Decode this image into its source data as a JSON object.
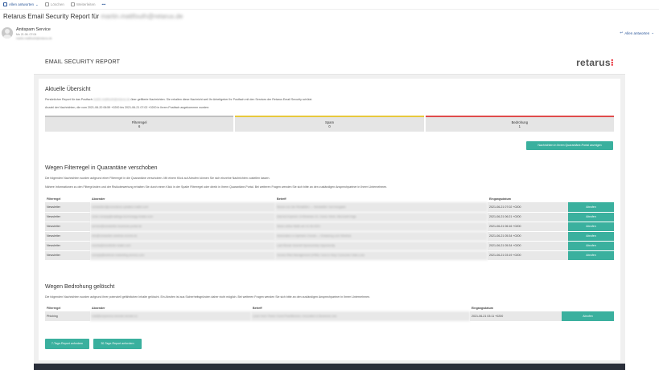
{
  "toolbar": {
    "reply_all": "Allen antworten",
    "delete": "Löschen",
    "forward": "Weiterleiten",
    "more": "•••"
  },
  "mail": {
    "subject": "Retarus Email Security Report für",
    "subject_address": "martin.mattfouth@retarus.de",
    "sender_name": "Antispam Service",
    "sender_date": "Mo 21.06. 07:04",
    "sender_to": "martin.mattfouth@retarus.de",
    "reply_all_label": "Allen antworten"
  },
  "report": {
    "title": "EMAIL SECURITY REPORT",
    "logo_text": "retarus",
    "logo_mark": "⁝",
    "overview": {
      "heading": "Aktuelle Übersicht",
      "line1_a": "Persönlicher Report für das Postfach",
      "line1_address": "martin.mattfouth@retarus.de",
      "line1_b": "über gefilterte Nachrichten. Sie erhalten diese Nachricht weil Ihr Arbeitgeber Ihr Postfach mit den Services der Retarus Email Security schützt.",
      "line2": "Anzahl der Nachrichten, die vom 2021-06-20 06:59 +0200 bis 2021-06-21 07:02 +0200 in Ihrem Postfach angekommen wurden:"
    },
    "stats": [
      {
        "label": "Filterregel",
        "value": "6",
        "color": "#c0c0c0"
      },
      {
        "label": "Spam",
        "value": "0",
        "color": "#e8c83c"
      },
      {
        "label": "Bedrohung",
        "value": "1",
        "color": "#e04b4b"
      }
    ],
    "release_all_button": "Nachrichten in Ihrem Quarantäne-Portal anzeigen",
    "quarantine": {
      "heading": "Wegen Filterregel in Quarantäne verschoben",
      "line1": "Die folgenden Nachrichten wurden aufgrund einer Filterregel in die Quarantäne verschoben. Mit einem Klick auf Abrufen können Sie sich einzelne Nachrichten zustellen lassen.",
      "line2": "Nähere Informationen zu den Filtergründen und der Risikobewertung erhalten Sie durch einen Klick in der Spalte Filterregel oder direkt in Ihrem Quarantäne-Portal. Bei weiteren Fragen wenden Sie sich bitte an den zuständigen Ansprechpartner in Ihrem Unternehmen.",
      "columns": [
        "Filterregel",
        "Absender",
        "Betreff",
        "Eingangsdatum",
        ""
      ],
      "rows": [
        {
          "rule": "Newsletter",
          "sender": "newsletter@promotions-updates-mailer.com",
          "subject": "Neues von der Redaktion — Newsletter Juni Ausgabe",
          "date": "2021-06-21 07:02 +0200",
          "action": "Abrufen"
        },
        {
          "rule": "Newsletter",
          "sender": "news-noreply@mailings-technology-insider.com",
          "subject": "Internet Explorer of Windows 10, Cloud, Work: Microsoft Edge",
          "date": "2021-06-21 06:21 +0200",
          "action": "Abrufen"
        },
        {
          "rule": "Newsletter",
          "sender": "service@newsletter-business-portal.de",
          "subject": "News online Nette am 21.06.2021",
          "date": "2021-06-21 06:16 +0200",
          "action": "Abrufen"
        },
        {
          "rule": "Newsletter",
          "sender": "info@newsletter-webinar-events.de",
          "subject": "Automation in hybriden Clouds — Einladung zum Webinar",
          "date": "2021-06-21 05:34 +0200",
          "action": "Abrufen"
        },
        {
          "rule": "Newsletter",
          "sender": "events@eventbrite-mailer.com",
          "subject": "Last Minute Summit Sponsorship Opportunity",
          "date": "2021-06-21 05:34 +0200",
          "action": "Abrufen"
        },
        {
          "rule": "Newsletter",
          "sender": "noreply@webinar-marketing-service.com",
          "subject": "Vendor Risk Management (VRM): How to Stop Consumer Data Loss",
          "date": "2021-06-21 03:19 +0200",
          "action": "Abrufen"
        }
      ]
    },
    "threat": {
      "heading": "Wegen Bedrohung gelöscht",
      "line1": "Die folgenden Nachrichten wurden aufgrund ihrer potenziell gefährlichen Inhalte gelöscht. Ein Abrufen ist aus Sicherheitsgründen daher nicht möglich. Bei weiteren Fragen wenden Sie sich bitte an den zuständigen Ansprechpartner in Ihrem Unternehmen.",
      "columns": [
        "Filterregel",
        "Absender",
        "Betreff",
        "Eingangsdatum",
        ""
      ],
      "rows": [
        {
          "rule": "Phishing",
          "sender": "mail@suspicious-domain-sender.co",
          "subject": "Learn from These Cloud Practitioners: Innovation & Business Use",
          "date": "2021-06-21 03:11 +0200",
          "action": "Abrufen"
        }
      ]
    },
    "footer_buttons": [
      "7-Tage-Report anfordern",
      "30-Tage-Report anfordern"
    ]
  }
}
